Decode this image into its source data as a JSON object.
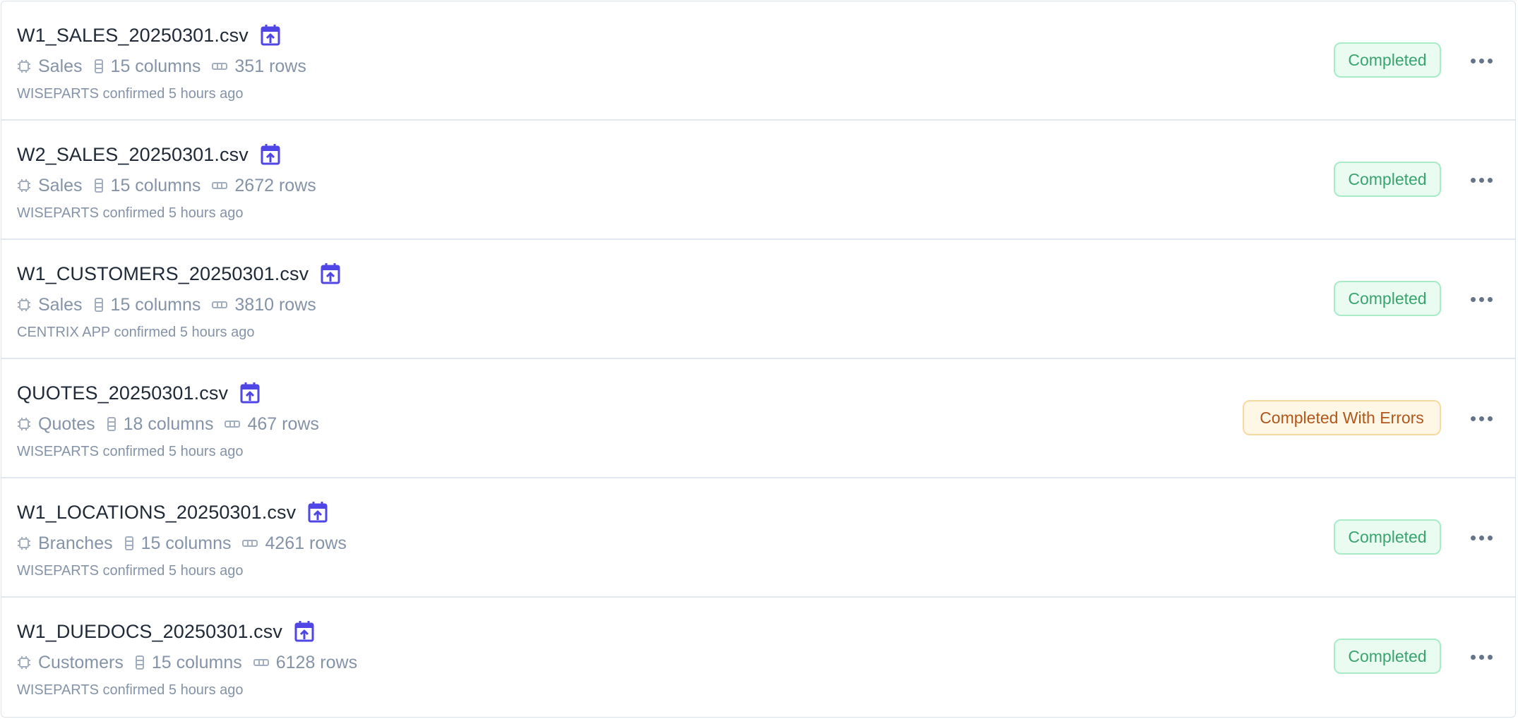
{
  "uploads": [
    {
      "filename": "W1_SALES_20250301.csv",
      "category": "Sales",
      "columns": "15 columns",
      "rows": "351 rows",
      "confirmed_by": "WISEPARTS",
      "confirmed_text": "confirmed 5 hours ago",
      "status": "Completed",
      "status_type": "success"
    },
    {
      "filename": "W2_SALES_20250301.csv",
      "category": "Sales",
      "columns": "15 columns",
      "rows": "2672 rows",
      "confirmed_by": "WISEPARTS",
      "confirmed_text": "confirmed 5 hours ago",
      "status": "Completed",
      "status_type": "success"
    },
    {
      "filename": "W1_CUSTOMERS_20250301.csv",
      "category": "Sales",
      "columns": "15 columns",
      "rows": "3810 rows",
      "confirmed_by": "CENTRIX APP",
      "confirmed_text": "confirmed 5 hours ago",
      "status": "Completed",
      "status_type": "success"
    },
    {
      "filename": "QUOTES_20250301.csv",
      "category": "Quotes",
      "columns": "18 columns",
      "rows": "467 rows",
      "confirmed_by": "WISEPARTS",
      "confirmed_text": "confirmed 5 hours ago",
      "status": "Completed With Errors",
      "status_type": "warning"
    },
    {
      "filename": "W1_LOCATIONS_20250301.csv",
      "category": "Branches",
      "columns": "15 columns",
      "rows": "4261 rows",
      "confirmed_by": "WISEPARTS",
      "confirmed_text": "confirmed 5 hours ago",
      "status": "Completed",
      "status_type": "success"
    },
    {
      "filename": "W1_DUEDOCS_20250301.csv",
      "category": "Customers",
      "columns": "15 columns",
      "rows": "6128 rows",
      "confirmed_by": "WISEPARTS",
      "confirmed_text": "confirmed 5 hours ago",
      "status": "Completed",
      "status_type": "success"
    }
  ],
  "icons": {
    "upload": "calendar-upload-icon",
    "category": "chip-icon",
    "columns": "columns-icon",
    "rows": "rows-icon",
    "more": "more-horizontal-icon"
  },
  "colors": {
    "accent": "#4f46e5",
    "success_text": "#3aa46e",
    "success_bg": "#eafbf2",
    "warning_text": "#b0571c",
    "warning_bg": "#fff7e6"
  }
}
